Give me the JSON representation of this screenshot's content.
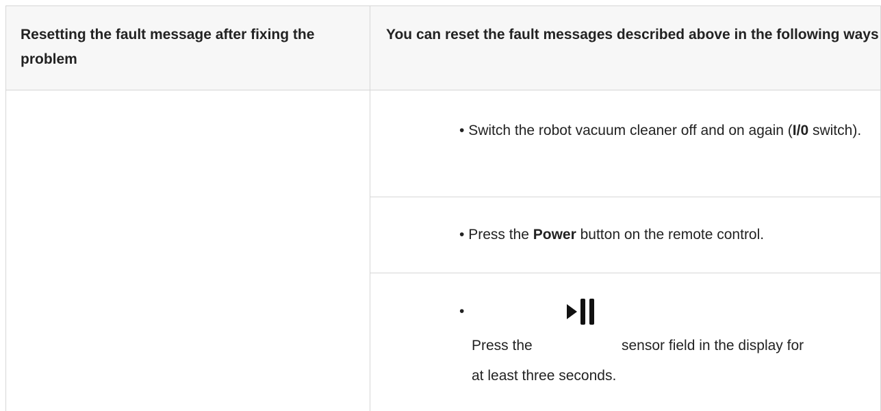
{
  "header": {
    "col1": "Resetting the fault message after fixing the problem",
    "col2": "You can reset the fault messages described above in the following ways"
  },
  "items": [
    {
      "bullet": "•",
      "pre": "Switch the robot vacuum cleaner off and on again (",
      "bold": "I/0",
      "post": " switch)."
    },
    {
      "bullet": "•",
      "pre": "Press the ",
      "bold": "Power",
      "post": " button on the remote control."
    },
    {
      "bullet": "•",
      "pre": "Press the",
      "icon": "play-pause-icon",
      "post": "sensor field in the display for",
      "post2": "at least three seconds."
    }
  ],
  "colors": {
    "header_bg": "#f7f7f7",
    "border": "#d6d6d6",
    "text": "#222222"
  }
}
